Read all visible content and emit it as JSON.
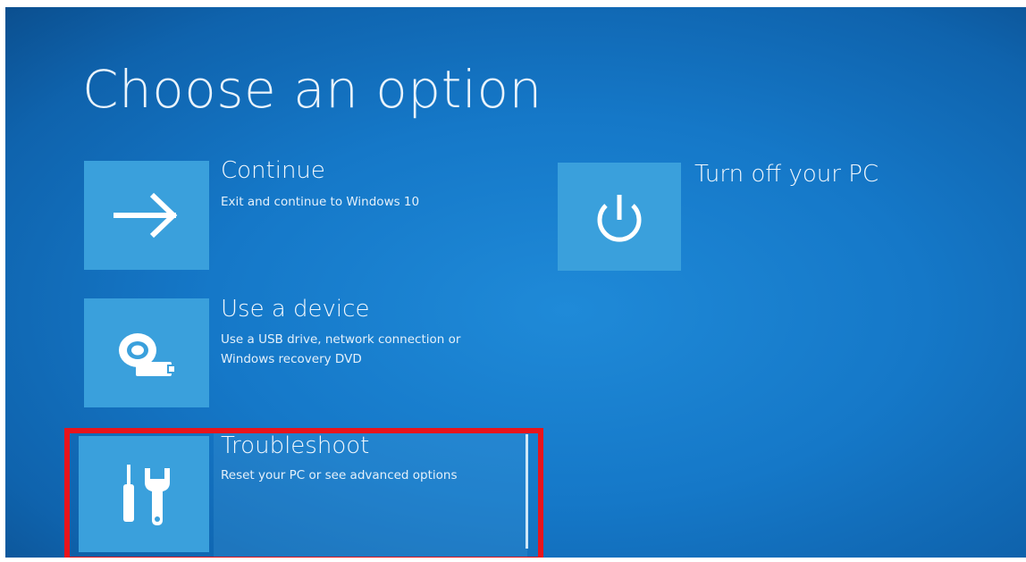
{
  "page": {
    "title": "Choose an option"
  },
  "options": [
    {
      "id": "continue",
      "title": "Continue",
      "desc_lines": [
        "Exit and continue to Windows 10"
      ],
      "icon": "arrow-right-icon"
    },
    {
      "id": "use-device",
      "title": "Use a device",
      "desc_lines": [
        "Use a USB drive, network connection or",
        "Windows recovery DVD"
      ],
      "icon": "disc-usb-icon"
    },
    {
      "id": "troubleshoot",
      "title": "Troubleshoot",
      "desc_lines": [
        "Reset your PC or see advanced options"
      ],
      "icon": "screwdriver-wrench-icon",
      "highlighted": true
    },
    {
      "id": "turn-off",
      "title": "Turn off your PC",
      "desc_lines": [],
      "icon": "power-icon"
    }
  ],
  "colors": {
    "background": "#1578c8",
    "tile": "#3aa0dc",
    "highlight_box": "#e8141c",
    "text": "#f2f8fd"
  }
}
